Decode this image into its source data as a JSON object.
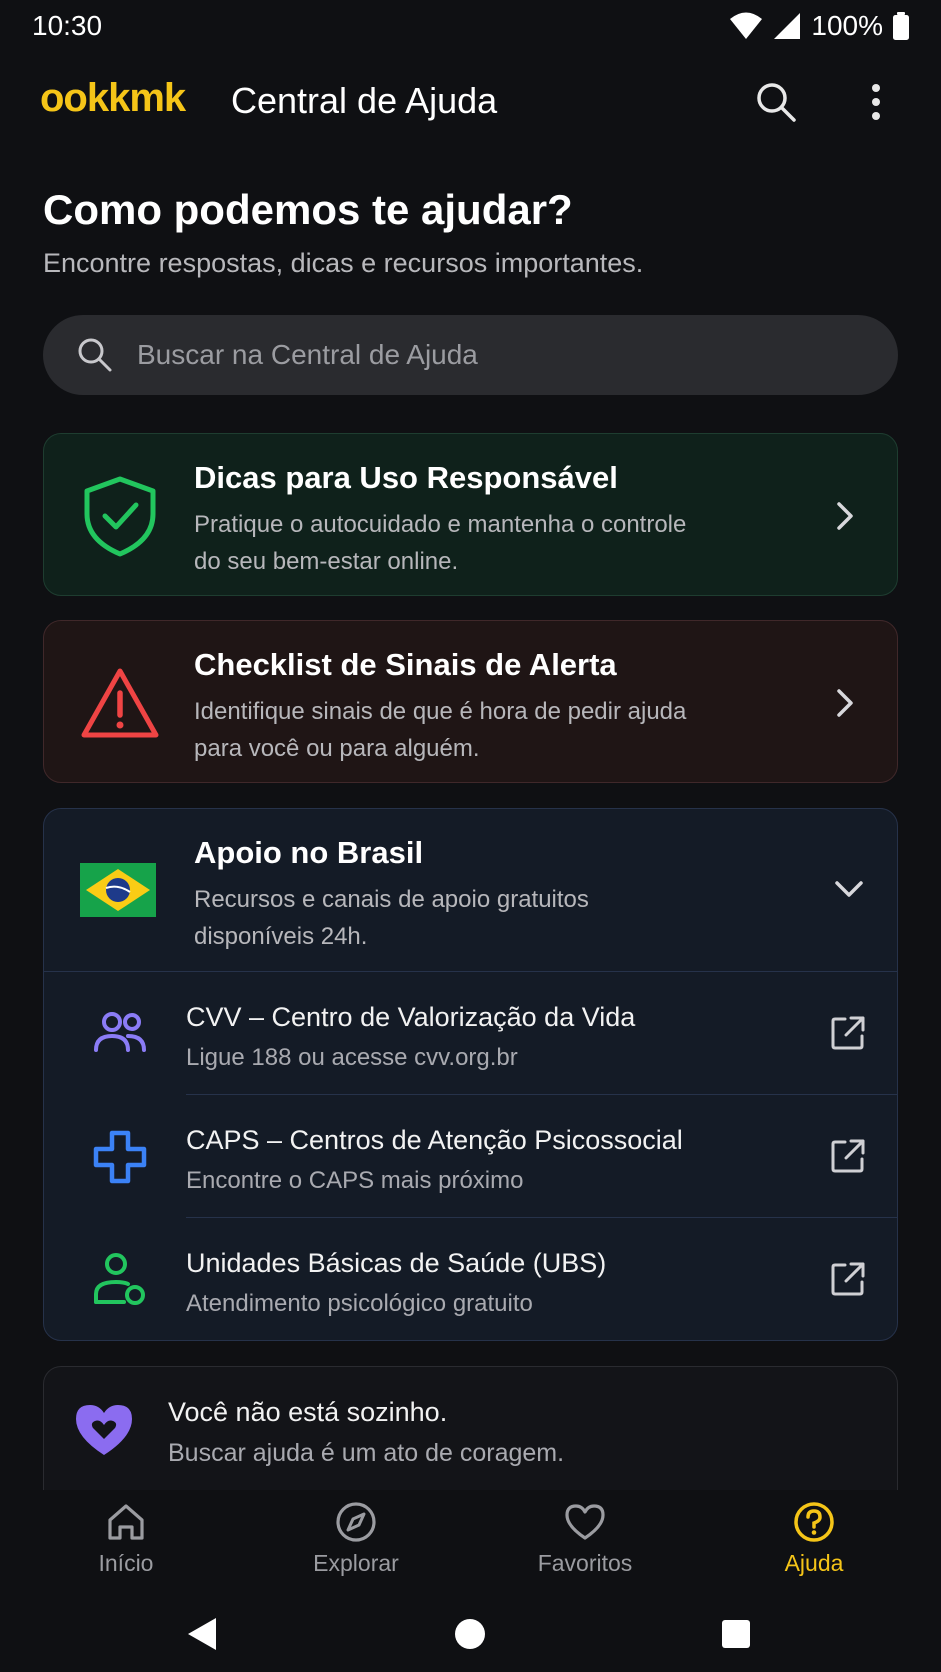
{
  "status_bar": {
    "time": "10:30",
    "battery": "100%"
  },
  "app_bar": {
    "brand": "ookkmk",
    "title": "Central de Ajuda"
  },
  "hero": {
    "title": "Como podemos te ajudar?",
    "subtitle": "Encontre respostas, dicas e recursos importantes."
  },
  "search": {
    "placeholder": "Buscar na Central de Ajuda",
    "value": ""
  },
  "cards": [
    {
      "title": "Dicas para Uso Responsável",
      "description": "Pratique o autocuidado e mantenha o controle do seu bem-estar online.",
      "icon": "shield-check-icon",
      "accent": "#22c55e"
    },
    {
      "title": "Checklist de Sinais de Alerta",
      "description": "Identifique sinais de que é hora de pedir ajuda para você ou para alguém.",
      "icon": "warning-triangle-icon",
      "accent": "#ef4444"
    }
  ],
  "support": {
    "title": "Apoio no Brasil",
    "description": "Recursos e canais de apoio gratuitos disponíveis 24h.",
    "icon": "brazil-flag-icon",
    "items": [
      {
        "title": "CVV – Centro de Valorização da Vida",
        "subtitle": "Ligue 188 ou acesse cvv.org.br",
        "icon": "people-icon",
        "accent": "#8b7cf6"
      },
      {
        "title": "CAPS – Centros de Atenção Psicossocial",
        "subtitle": "Encontre o CAPS mais próximo",
        "icon": "medical-cross-icon",
        "accent": "#3b82f6"
      },
      {
        "title": "Unidades Básicas de Saúde (UBS)",
        "subtitle": "Atendimento psicológico gratuito",
        "icon": "health-worker-icon",
        "accent": "#22c55e"
      }
    ]
  },
  "banner": {
    "title": "Você não está sozinho.",
    "subtitle": "Buscar ajuda é um ato de coragem.",
    "icon": "heart-icon",
    "accent": "#8b6cf0"
  },
  "bottom_nav": {
    "active": "Ajuda",
    "active_color": "#f5c518",
    "items": [
      {
        "label": "Início",
        "icon": "home-icon"
      },
      {
        "label": "Explorar",
        "icon": "compass-icon"
      },
      {
        "label": "Favoritos",
        "icon": "heart-outline-icon"
      },
      {
        "label": "Ajuda",
        "icon": "help-circle-icon"
      }
    ]
  }
}
